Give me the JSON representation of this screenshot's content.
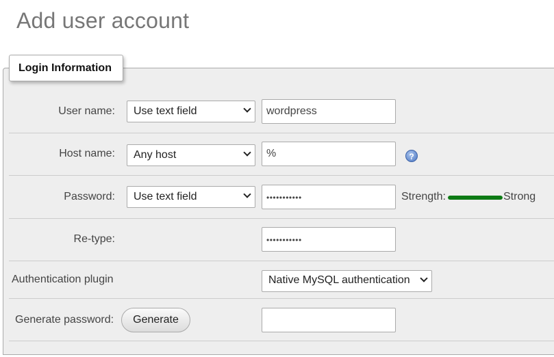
{
  "page": {
    "title": "Add user account"
  },
  "fieldset": {
    "legend": "Login Information"
  },
  "username": {
    "label": "User name:",
    "select_value": "Use text field",
    "input_value": "wordpress"
  },
  "hostname": {
    "label": "Host name:",
    "select_value": "Any host",
    "input_value": "%",
    "help_icon": "help-icon"
  },
  "password": {
    "label": "Password:",
    "select_value": "Use text field",
    "input_value": "•••••••••••",
    "strength_label": "Strength:",
    "strength_value": "Strong",
    "strength_level": 1.0,
    "strength_color": "#0d7a14"
  },
  "retype": {
    "label": "Re-type:",
    "input_value": "•••••••••••"
  },
  "auth": {
    "label": "Authentication plugin",
    "select_value": "Native MySQL authentication"
  },
  "generate": {
    "label": "Generate password:",
    "button_label": "Generate",
    "input_value": ""
  }
}
